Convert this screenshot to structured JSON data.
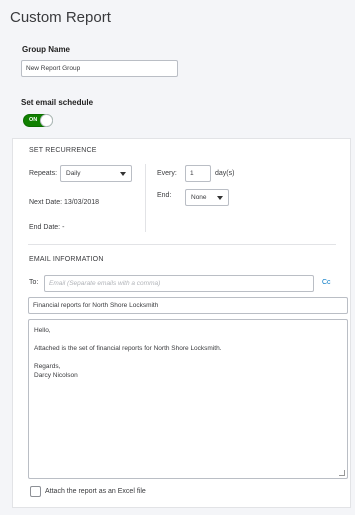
{
  "page": {
    "title": "Custom Report"
  },
  "group": {
    "label": "Group Name",
    "value": "New Report Group"
  },
  "schedule": {
    "label": "Set email schedule",
    "toggle_text": "ON"
  },
  "recurrence": {
    "title": "SET RECURRENCE",
    "repeats_label": "Repeats:",
    "repeats_value": "Daily",
    "next_date": "Next Date: 13/03/2018",
    "end_date": "End Date: -",
    "every_label": "Every:",
    "every_value": "1",
    "every_unit": "day(s)",
    "end_label": "End:",
    "end_value": "None"
  },
  "email": {
    "title": "EMAIL INFORMATION",
    "to_label": "To:",
    "to_placeholder": "Email (Separate emails with a comma)",
    "cc_link": "Cc",
    "subject": "Financial reports for North Shore Locksmith",
    "body_line1": "Hello,",
    "body_line2": "Attached is the set of financial reports for North Shore Locksmith.",
    "body_line3": "Regards,",
    "body_line4": "Darcy Nicolson",
    "attach_label": "Attach the report as an Excel file"
  }
}
